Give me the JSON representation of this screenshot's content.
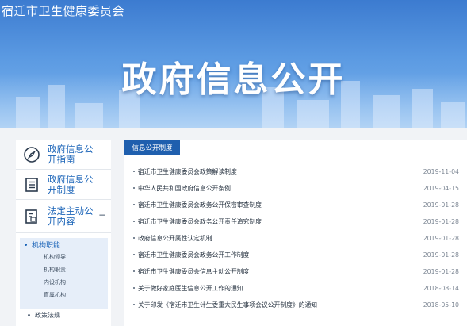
{
  "header": {
    "site_name": "宿迁市卫生健康委员会",
    "banner_title": "政府信息公开"
  },
  "sidebar": {
    "items": [
      {
        "label": "政府信息公开指南",
        "icon": "compass-icon"
      },
      {
        "label": "政府信息公开制度",
        "icon": "document-list-icon"
      },
      {
        "label": "法定主动公开内容",
        "icon": "document-edit-icon",
        "toggle": "−"
      }
    ],
    "submenu": {
      "head": "机构职能",
      "toggle": "−",
      "items": [
        "机构领导",
        "机构职责",
        "内设机构",
        "直属机构"
      ]
    },
    "next_item": "政策法规"
  },
  "main": {
    "tab": "信息公开制度",
    "rows": [
      {
        "title": "宿迁市卫生健康委员会政策解读制度",
        "date": "2019-11-04"
      },
      {
        "title": "中华人民共和国政府信息公开条例",
        "date": "2019-04-15"
      },
      {
        "title": "宿迁市卫生健康委员会政务公开保密审查制度",
        "date": "2019-01-28"
      },
      {
        "title": "宿迁市卫生健康委员会政务公开责任追究制度",
        "date": "2019-01-28"
      },
      {
        "title": "政府信息公开属性认定机制",
        "date": "2019-01-28"
      },
      {
        "title": "宿迁市卫生健康委员会政务公开工作制度",
        "date": "2019-01-28"
      },
      {
        "title": "宿迁市卫生健康委员会信息主动公开制度",
        "date": "2019-01-28"
      },
      {
        "title": "关于做好家庭医生信息公开工作的通知",
        "date": "2018-08-14"
      },
      {
        "title": "关于印发《宿迁市卫生计生委重大民生事项会议公开制度》的通知",
        "date": "2018-05-10"
      }
    ]
  },
  "colors": {
    "accent": "#1f5fae",
    "link": "#1b64b8",
    "banner_top": "#3c7bd0",
    "page_bg": "#f1f3f6"
  }
}
